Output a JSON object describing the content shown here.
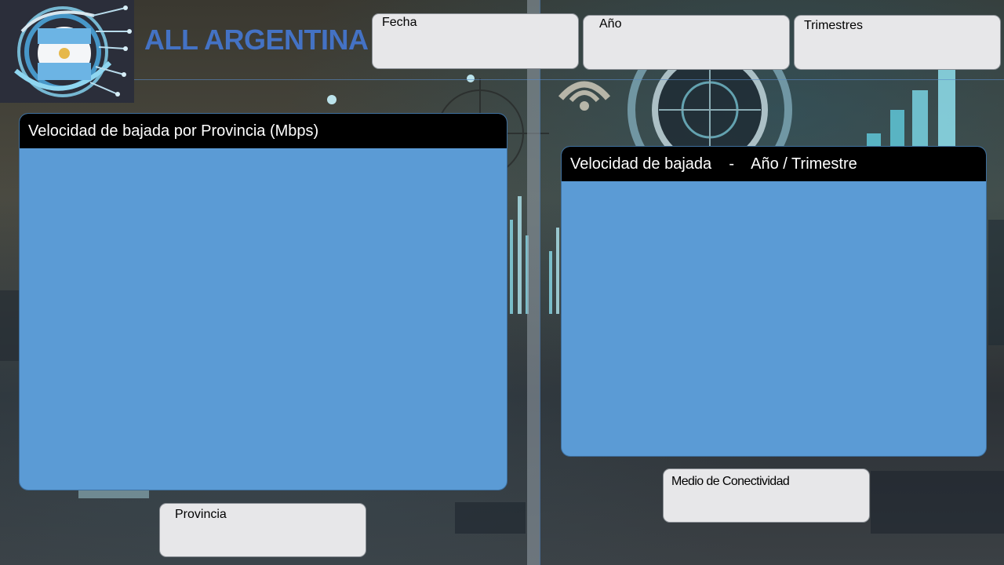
{
  "header": {
    "brand_title": "ALL ARGENTINA"
  },
  "filters": {
    "fecha_label": "Fecha",
    "anio_label": "Año",
    "trimestres_label": "Trimestres",
    "provincia_label": "Provincia",
    "medio_label": "Medio de Conectividad"
  },
  "panels": {
    "left_title": "Velocidad de bajada por Provincia (Mbps)",
    "right_title": "Velocidad de bajada    -    Año / Trimestre"
  },
  "colors": {
    "accent": "#4472c4",
    "panel_fill": "#5b9bd5",
    "panel_header": "#000000",
    "filter_fill": "#e7e7e9"
  }
}
